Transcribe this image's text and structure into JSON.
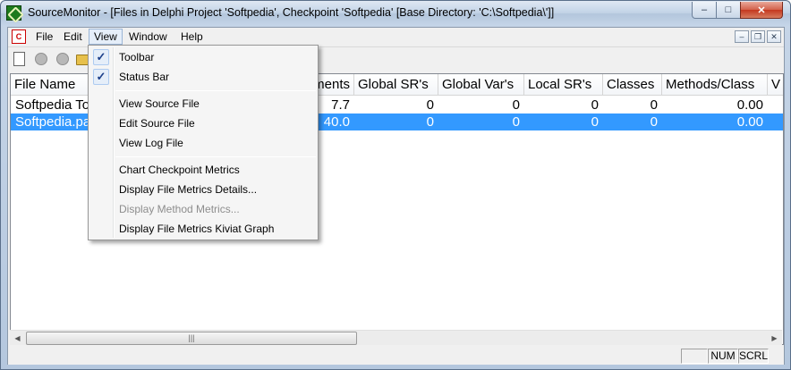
{
  "window": {
    "title": "SourceMonitor - [Files in Delphi Project 'Softpedia', Checkpoint 'Softpedia'  [Base Directory: 'C:\\Softpedia\\']]",
    "minimize": "–",
    "maximize": "□",
    "close": "✕"
  },
  "menubar": {
    "doc_icon": "C",
    "items": [
      "File",
      "Edit",
      "View",
      "Window",
      "Help"
    ],
    "mdi_minimize": "–",
    "mdi_restore": "❐",
    "mdi_close": "✕"
  },
  "table": {
    "columns": [
      "File Name",
      "ments",
      "Global SR's",
      "Global Var's",
      "Local SR's",
      "Classes",
      "Methods/Class",
      "V"
    ],
    "rows": [
      {
        "name": "Softpedia To",
        "statements": "7.7",
        "global_sr": "0",
        "global_var": "0",
        "local_sr": "0",
        "classes": "0",
        "methods_class": "0.00",
        "selected": false
      },
      {
        "name": "Softpedia.pa",
        "statements": "40.0",
        "global_sr": "0",
        "global_var": "0",
        "local_sr": "0",
        "classes": "0",
        "methods_class": "0.00",
        "selected": true
      }
    ]
  },
  "scrollbar": {
    "left_arrow": "◀",
    "right_arrow": "▶",
    "thumb_grip": "|||"
  },
  "status": {
    "pane1": "",
    "num": "NUM",
    "scrl": "SCRL"
  },
  "view_menu": {
    "items": [
      {
        "label": "Toolbar",
        "checked": true,
        "disabled": false
      },
      {
        "label": "Status Bar",
        "checked": true,
        "disabled": false
      },
      {
        "label": "View Source File",
        "checked": false,
        "disabled": false
      },
      {
        "label": "Edit Source File",
        "checked": false,
        "disabled": false
      },
      {
        "label": "View Log File",
        "checked": false,
        "disabled": false
      },
      {
        "label": "Chart Checkpoint Metrics",
        "checked": false,
        "disabled": false
      },
      {
        "label": "Display File Metrics Details...",
        "checked": false,
        "disabled": false
      },
      {
        "label": "Display Method Metrics...",
        "checked": false,
        "disabled": true
      },
      {
        "label": "Display File Metrics Kiviat Graph",
        "checked": false,
        "disabled": false
      }
    ],
    "check_mark": "✓"
  },
  "colors": {
    "selection": "#3399ff",
    "close_button": "#c4381f"
  }
}
